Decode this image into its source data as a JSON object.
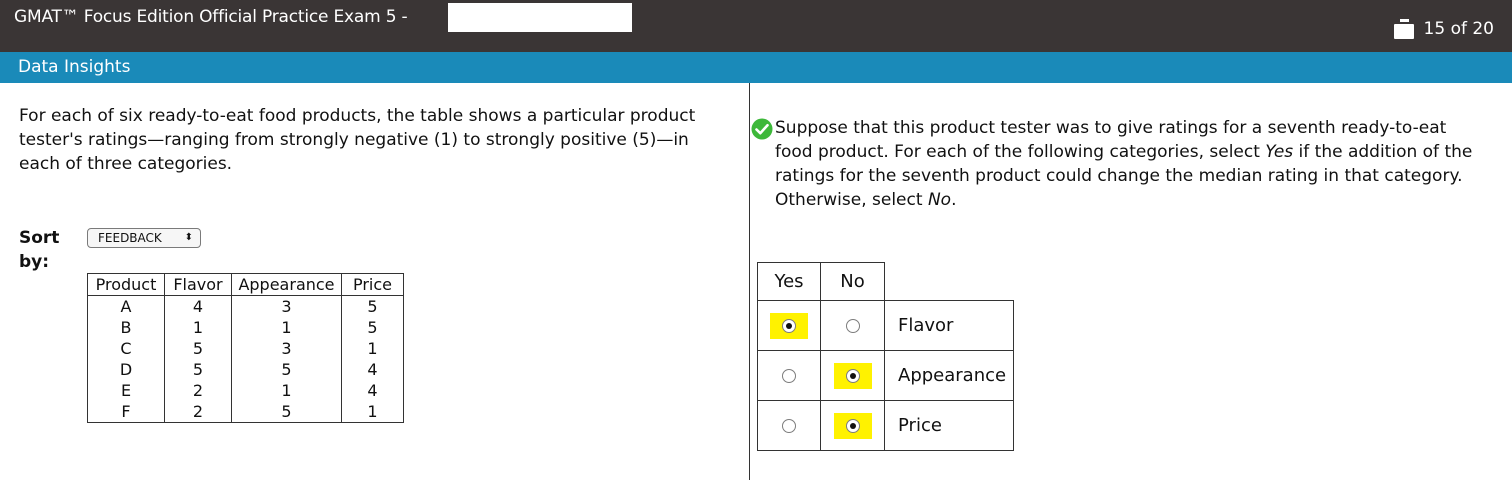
{
  "header": {
    "exam_title": "GMAT™ Focus Edition Official Practice Exam 5 -",
    "progress": "15 of 20",
    "progress_icon": "question-list-icon"
  },
  "section": {
    "title": "Data Insights"
  },
  "left": {
    "intro": "For each of six ready-to-eat food products, the table shows a particular product tester's ratings—ranging from strongly negative (1) to strongly positive (5)—in each of three categories.",
    "sort": {
      "label": "Sort by:",
      "selected": "FEEDBACK"
    },
    "table": {
      "headers": [
        "Product",
        "Flavor",
        "Appearance",
        "Price"
      ],
      "rows": [
        [
          "A",
          "4",
          "3",
          "5"
        ],
        [
          "B",
          "1",
          "1",
          "5"
        ],
        [
          "C",
          "5",
          "3",
          "1"
        ],
        [
          "D",
          "5",
          "5",
          "4"
        ],
        [
          "E",
          "2",
          "1",
          "4"
        ],
        [
          "F",
          "2",
          "5",
          "1"
        ]
      ]
    }
  },
  "right": {
    "status_icon": "correct-check-icon",
    "status_color": "#3db83a",
    "question_parts": {
      "p1": "Suppose that this product tester was to give ratings for a seventh ready-to-eat food product. For each of the following categories, select ",
      "yes": "Yes",
      "p2": " if the addition of the ratings for the seventh product could change the median rating in that category. Otherwise, select ",
      "no": "No",
      "p3": "."
    },
    "answer_table": {
      "col_yes": "Yes",
      "col_no": "No",
      "rows": [
        {
          "category": "Flavor",
          "selected": "Yes"
        },
        {
          "category": "Appearance",
          "selected": "No"
        },
        {
          "category": "Price",
          "selected": "No"
        }
      ]
    },
    "highlight_color": "#fff200"
  }
}
